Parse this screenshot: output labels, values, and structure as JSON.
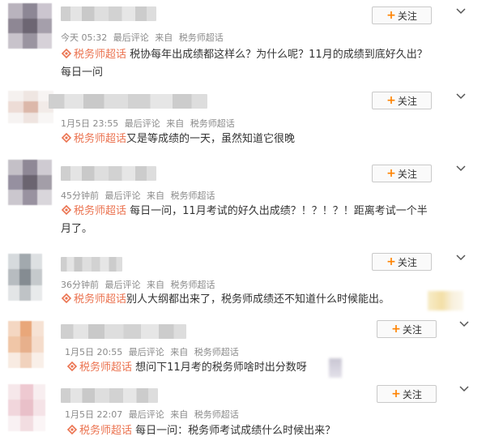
{
  "common": {
    "follow_label": "关注",
    "follow_plus": "+",
    "last_comment": "最后评论",
    "from_prefix": "来自",
    "source": "税务师超话",
    "tag_label": "税务师超话"
  },
  "posts": [
    {
      "time": "今天 05:32",
      "text": "税协每年出成绩都这样么？为什么呢？11月的成绩到底好久出？",
      "text2": "每日一问"
    },
    {
      "time": "1月5日 23:55",
      "text": "又是等成绩的一天，虽然知道它很晚"
    },
    {
      "time": "45分钟前",
      "text": "每日一问，11月考试的好久出成绩？！？！？！距离考试一个半",
      "text2": "月了。"
    },
    {
      "time": "36分钟前",
      "text": "别人大纲都出来了，税务师成绩还不知道什么时候能出。"
    },
    {
      "time": "1月5日 20:55",
      "text": "想问下11月考的税务师啥时出分数呀"
    },
    {
      "time": "1月5日 22:07",
      "text": "每日一问：税务师考试成绩什么时候出来？"
    }
  ],
  "colors": {
    "tag": "#eb7350",
    "plus": "#ff8200",
    "meta": "#8a8a8a"
  }
}
